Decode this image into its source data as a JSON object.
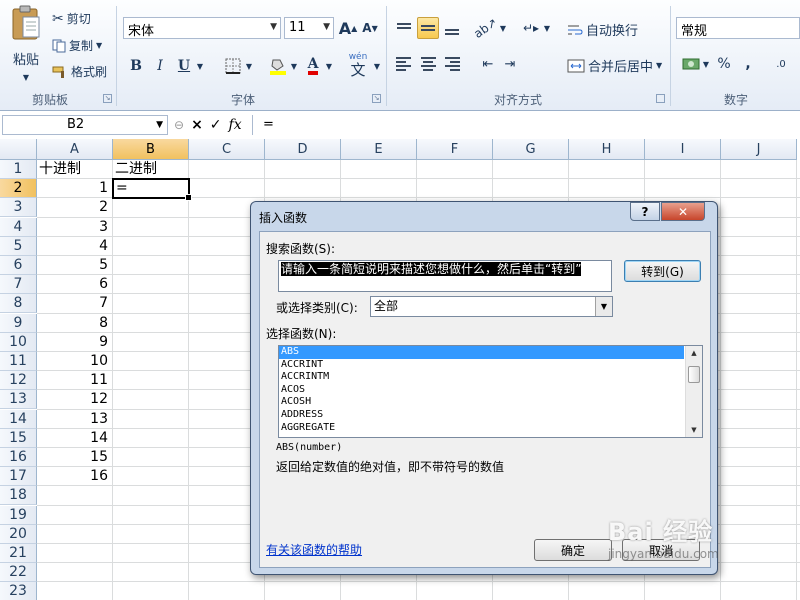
{
  "clipboard": {
    "paste": "粘贴",
    "cut": "剪切",
    "copy": "复制",
    "format_painter": "格式刷",
    "group": "剪贴板"
  },
  "font": {
    "name": "宋体",
    "size": "11",
    "group": "字体",
    "bold": "B",
    "italic": "I",
    "underline": "U",
    "grow": "A",
    "shrink": "A",
    "wen": "wén",
    "wen_char": "文"
  },
  "alignment": {
    "wrap_text": "自动换行",
    "merge_center": "合并后居中",
    "group": "对齐方式"
  },
  "number": {
    "format": "常规",
    "percent": "%",
    "comma": ",",
    "group": "数字"
  },
  "formula_bar": {
    "name_box": "B2",
    "fx": "fx",
    "cancel": "×",
    "enter": "✓",
    "formula": "="
  },
  "columns": [
    "A",
    "B",
    "C",
    "D",
    "E",
    "F",
    "G",
    "H",
    "I",
    "J"
  ],
  "rows": [
    "1",
    "2",
    "3",
    "4",
    "5",
    "6",
    "7",
    "8",
    "9",
    "10",
    "11",
    "12",
    "13",
    "14",
    "15",
    "16",
    "17",
    "18",
    "19",
    "20",
    "21",
    "22",
    "23"
  ],
  "cells": {
    "a1": "十进制",
    "b1": "二进制",
    "b2": "=",
    "a_values": [
      "1",
      "2",
      "3",
      "4",
      "5",
      "6",
      "7",
      "8",
      "9",
      "10",
      "11",
      "12",
      "13",
      "14",
      "15",
      "16"
    ]
  },
  "dialog": {
    "title": "插入函数",
    "help_btn": "?",
    "close_btn": "✕",
    "search_label": "搜索函数(S):",
    "search_text": "请输入一条简短说明来描述您想做什么，然后单击“转到”",
    "go_button": "转到(G)",
    "category_label": "或选择类别(C):",
    "category_value": "全部",
    "function_label": "选择函数(N):",
    "functions": [
      "ABS",
      "ACCRINT",
      "ACCRINTM",
      "ACOS",
      "ACOSH",
      "ADDRESS",
      "AGGREGATE"
    ],
    "signature": "ABS(number)",
    "description": "返回给定数值的绝对值，即不带符号的数值",
    "help_link": "有关该函数的帮助",
    "ok_button": "确定",
    "cancel_button": "取消"
  },
  "watermark": {
    "line1": "Bai 经验",
    "line2": "jingyan.baidu.com"
  }
}
